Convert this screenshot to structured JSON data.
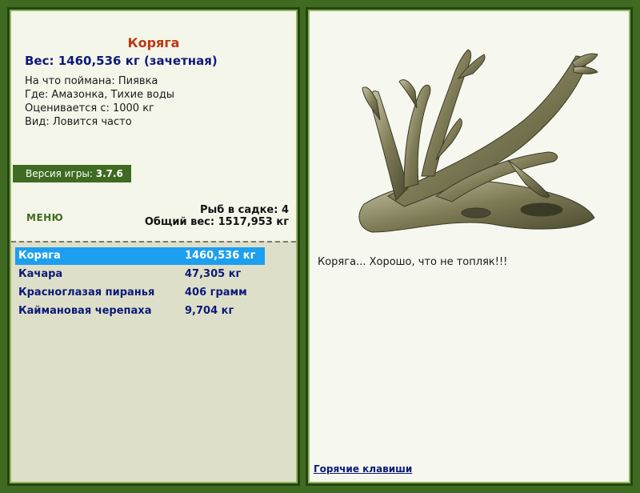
{
  "fish": {
    "name": "Коряга",
    "weight_line": "Вес: 1460,536 кг (зачетная)",
    "caught_on": "На что поймана: Пиявка",
    "location": "Где: Амазонка, Тихие воды",
    "valued_from": "Оценивается с: 1000 кг",
    "frequency": "Вид: Ловится часто",
    "comment": "Коряга... Хорошо, что не топляк!!!"
  },
  "version": {
    "label": "Версия игры:",
    "number": "3.7.6"
  },
  "menu_label": "МЕНЮ",
  "keepnet": {
    "count_line": "Рыб в садке: 4",
    "total_line": "Общий вес: 1517,953 кг"
  },
  "catch_list": [
    {
      "name": "Коряга",
      "weight": "1460,536 кг",
      "selected": true
    },
    {
      "name": "Качара",
      "weight": "47,305 кг",
      "selected": false
    },
    {
      "name": "Красноглазая пиранья",
      "weight": "406 грамм",
      "selected": false
    },
    {
      "name": "Каймановая черепаха",
      "weight": "9,704 кг",
      "selected": false
    }
  ],
  "hotkeys_label": "Горячие клавиши",
  "colors": {
    "frame_green": "#3e6b21",
    "title_red": "#c0360f",
    "text_navy": "#0c1a78",
    "selection_blue": "#1d9ff0",
    "list_bg": "#dedfc8"
  },
  "icons": {
    "fish_image": "driftwood-image"
  }
}
